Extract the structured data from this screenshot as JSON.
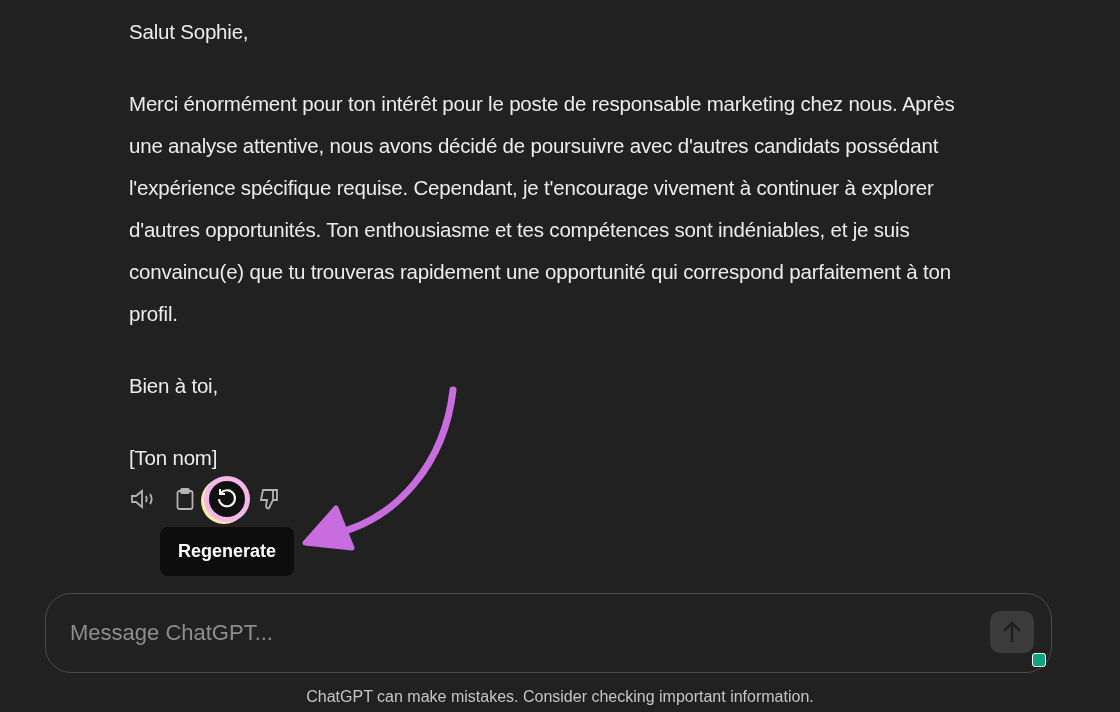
{
  "message": {
    "paragraphs": [
      "Salut Sophie,",
      "Merci énormément pour ton intérêt pour le poste de responsable marketing chez nous. Après une analyse attentive, nous avons décidé de poursuivre avec d'autres candidats possédant l'expérience spécifique requise. Cependant, je t'encourage vivement à continuer à explorer d'autres opportunités. Ton enthousiasme et tes compétences sont indéniables, et je suis convaincu(e) que tu trouveras rapidement une opportunité qui correspond parfaitement à ton profil.",
      "Bien à toi,",
      "[Ton nom]"
    ],
    "actions": [
      {
        "kind": "speaker",
        "highlighted": false
      },
      {
        "kind": "copy",
        "highlighted": false
      },
      {
        "kind": "regenerate",
        "highlighted": true,
        "tooltip": "Regenerate"
      },
      {
        "kind": "dislike",
        "highlighted": false
      }
    ]
  },
  "composer": {
    "placeholder": "Message ChatGPT..."
  },
  "footer": "ChatGPT can make mistakes. Consider checking important information."
}
